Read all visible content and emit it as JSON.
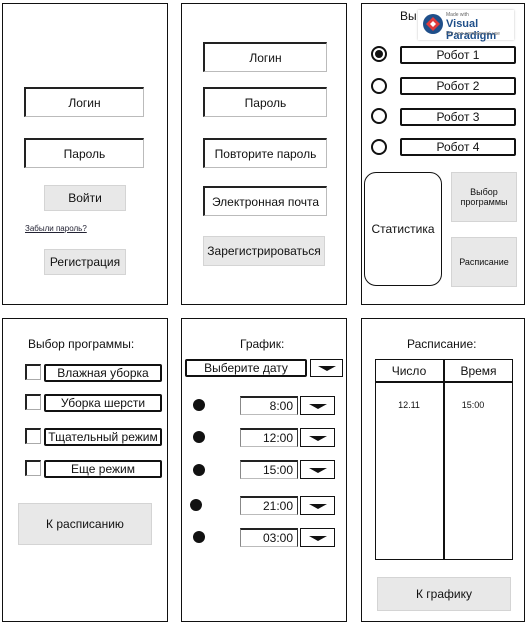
{
  "login": {
    "login_field": "Логин",
    "password_field": "Пароль",
    "enter_button": "Войти",
    "forgot_link": "Забыли пароль?",
    "register_button": "Регистрация"
  },
  "register": {
    "login_field": "Логин",
    "password_field": "Пароль",
    "repeat_field": "Повторите пароль",
    "email_field": "Электронная почта",
    "submit_button": "Зарегистрироваться"
  },
  "robots": {
    "title": "Вы",
    "items": [
      {
        "label": "Робот 1",
        "selected": true
      },
      {
        "label": "Робот 2",
        "selected": false
      },
      {
        "label": "Робот 3",
        "selected": false
      },
      {
        "label": "Робот 4",
        "selected": false
      }
    ],
    "stats_button": "Статистика",
    "program_button": "Выбор программы",
    "schedule_button": "Расписание"
  },
  "program": {
    "title": "Выбор программы:",
    "options": [
      "Влажная уборка",
      "Уборка шерсти",
      "Тщательный режим",
      "Еще режим"
    ],
    "to_schedule_button": "К расписанию"
  },
  "graph": {
    "title": "График:",
    "date_select": "Выберите дату",
    "times": [
      "8:00",
      "12:00",
      "15:00",
      "21:00",
      "03:00"
    ]
  },
  "schedule": {
    "title": "Расписание:",
    "headers": [
      "Число",
      "Время"
    ],
    "rows": [
      [
        "12.11",
        "15:00"
      ]
    ],
    "to_graph_button": "К графику"
  },
  "watermark": {
    "line1": "Made with",
    "line2": "Visual Paradigm",
    "line3": "For non-commercial use"
  }
}
